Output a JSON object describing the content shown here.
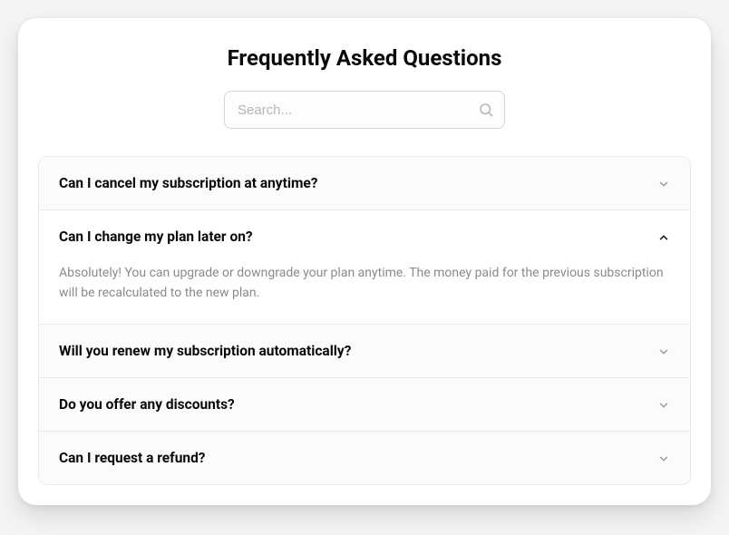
{
  "title": "Frequently Asked Questions",
  "search": {
    "placeholder": "Search..."
  },
  "faqs": [
    {
      "question": "Can I cancel my subscription at anytime?",
      "answer": "",
      "expanded": false
    },
    {
      "question": "Can I change my plan later on?",
      "answer": "Absolutely! You can upgrade or downgrade your plan anytime. The money paid for the previous subscription will be recalculated to the new plan.",
      "expanded": true
    },
    {
      "question": "Will you renew my subscription automatically?",
      "answer": "",
      "expanded": false
    },
    {
      "question": "Do you offer any discounts?",
      "answer": "",
      "expanded": false
    },
    {
      "question": "Can I request a refund?",
      "answer": "",
      "expanded": false
    }
  ]
}
